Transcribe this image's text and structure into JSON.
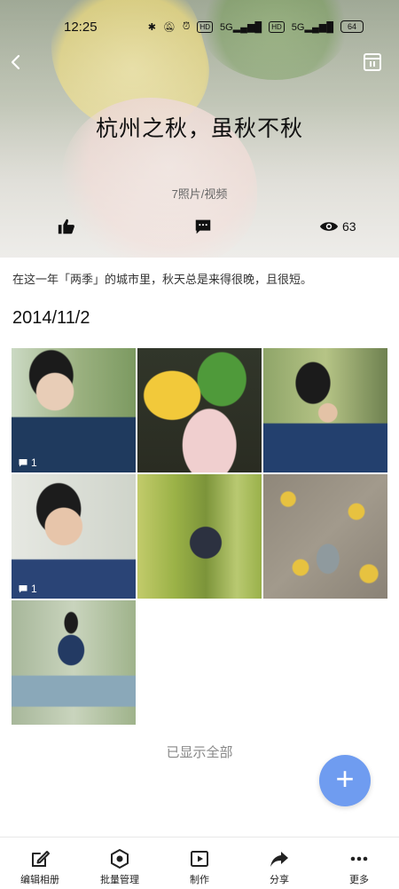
{
  "status_bar": {
    "time": "12:25",
    "hd1": "HD",
    "hd2": "HD",
    "net1": "5G",
    "net2": "5G",
    "battery": "64"
  },
  "album": {
    "title": "杭州之秋，虽秋不秋",
    "count": "7照片/视频",
    "views": "63",
    "description": "在这一年「两季」的城市里，秋天总是来得很晚，且很短。"
  },
  "section": {
    "date": "2014/11/2"
  },
  "photos": [
    {
      "badge": "1"
    },
    {
      "badge": ""
    },
    {
      "badge": ""
    },
    {
      "badge": "1"
    },
    {
      "badge": ""
    },
    {
      "badge": ""
    },
    {
      "badge": ""
    }
  ],
  "footer_text": "已显示全部",
  "fab_icon": "plus-icon",
  "bottom_bar": {
    "items": [
      {
        "label": "编辑相册",
        "icon": "edit-icon"
      },
      {
        "label": "批量管理",
        "icon": "batch-icon"
      },
      {
        "label": "制作",
        "icon": "play-icon"
      },
      {
        "label": "分享",
        "icon": "share-icon"
      },
      {
        "label": "更多",
        "icon": "more-icon"
      }
    ]
  },
  "colors": {
    "fab": "#6f9cf0",
    "text": "#111111",
    "muted": "#888888"
  }
}
